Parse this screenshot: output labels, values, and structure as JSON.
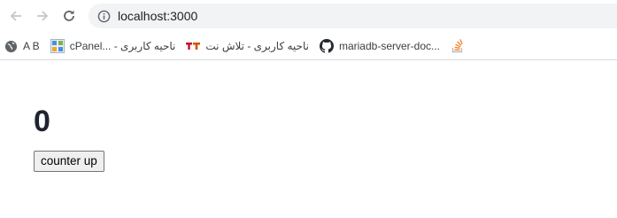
{
  "browser": {
    "url": "localhost:3000",
    "bookmarks": [
      {
        "label": "A B",
        "icon": "globe-icon"
      },
      {
        "label": "cPanel... - ناحیه کاربری",
        "icon": "cpanel-icon"
      },
      {
        "label": "ناحیه کاربری - تلاش نت",
        "icon": "tt-icon"
      },
      {
        "label": "mariadb-server-doc...",
        "icon": "github-icon"
      },
      {
        "label": "",
        "icon": "stackoverflow-icon"
      }
    ]
  },
  "app": {
    "count": "0",
    "button_label": "counter up"
  },
  "colors": {
    "omnibox_bg": "#f1f3f4",
    "count_text": "#1f2430",
    "button_bg": "#efefef",
    "tt_brand": "#c8102e",
    "stackoverflow_brand": "#f48024"
  }
}
